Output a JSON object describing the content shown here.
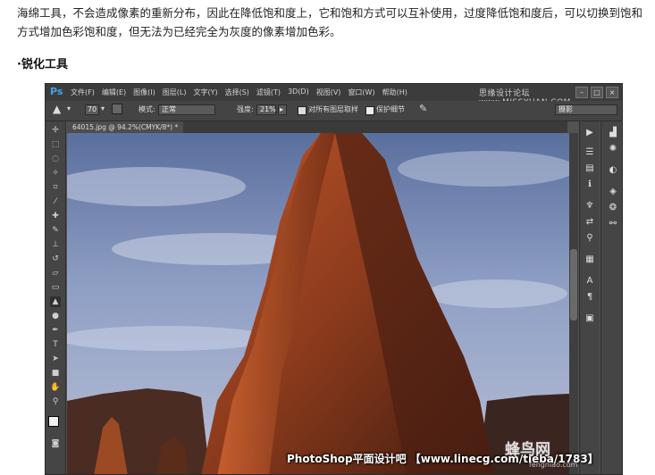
{
  "article": {
    "intro": "海绵工具，不会造成像素的重新分布，因此在降低饱和度上，它和饱和方式可以互补使用，过度降低饱和度后，可以切换到饱和方式增加色彩饱和度，但无法为已经完全为灰度的像素增加色彩。",
    "heading": "·锐化工具"
  },
  "photoshop": {
    "logo": "Ps",
    "menu": [
      "文件(F)",
      "编辑(E)",
      "图像(I)",
      "图层(L)",
      "文字(Y)",
      "选择(S)",
      "滤镜(T)",
      "3D(D)",
      "视图(V)",
      "窗口(W)",
      "帮助(H)"
    ],
    "watermark": "思缘设计论坛 www.MISSYUAN.COM",
    "window_buttons": [
      "–",
      "□",
      "×"
    ],
    "options": {
      "brush_size": "70",
      "mode_label": "模式:",
      "mode_value": "正常",
      "strength_label": "强度:",
      "strength_value": "21%",
      "sample_all_layers": "对所有图层取样",
      "protect_detail": "保护细节",
      "workspace": "摄影"
    },
    "document_tab": "64015.jpg @ 94.2%(CMYK/8*) *",
    "tools": [
      "move-tool",
      "marquee-tool",
      "lasso-tool",
      "quick-select-tool",
      "crop-tool",
      "eyedropper-tool",
      "healing-tool",
      "brush-tool",
      "clone-stamp-tool",
      "history-brush-tool",
      "eraser-tool",
      "gradient-tool",
      "sharpen-tool",
      "dodge-tool",
      "pen-tool",
      "type-tool",
      "path-select-tool",
      "shape-tool",
      "hand-tool",
      "zoom-tool"
    ]
  },
  "overlay": {
    "caption": "PhotoShop平面设计吧 【www.linecg.com/tieba/1783】",
    "site_logo": "蜂鸟网",
    "site_url": "fengniao.com"
  }
}
